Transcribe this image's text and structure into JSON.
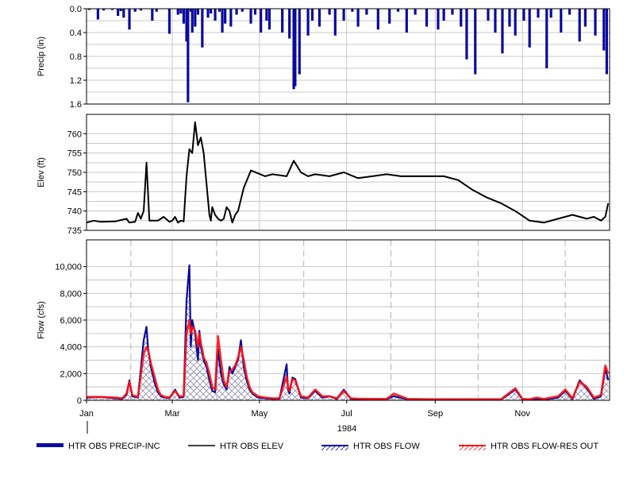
{
  "chart_data": [
    {
      "type": "bar",
      "ylabel": "Precip (in)",
      "ylim": [
        1.6,
        0.0
      ],
      "yticks": [
        "0.0",
        "0.4",
        "0.8",
        "1.2",
        "1.6"
      ],
      "ytick_values": [
        0.0,
        0.4,
        0.8,
        1.2,
        1.6
      ],
      "inverted_y": true,
      "grid": true,
      "series": [
        {
          "name": "HTR OBS PRECIP-INC",
          "color": "#0a0aa0",
          "x": [
            2,
            8,
            12,
            18,
            22,
            24,
            26,
            30,
            34,
            38,
            46,
            49,
            58,
            64,
            66,
            68,
            70,
            71,
            73,
            74,
            76,
            78,
            81,
            85,
            87,
            90,
            93,
            95,
            97,
            101,
            105,
            109,
            115,
            118,
            122,
            126,
            128,
            137,
            142,
            145,
            146,
            149,
            155,
            158,
            163,
            170,
            174,
            180,
            186,
            190,
            196,
            204,
            212,
            218,
            224,
            230,
            238,
            246,
            250,
            256,
            262,
            266,
            272,
            281,
            286,
            291,
            296,
            300,
            306,
            310,
            316,
            322,
            325,
            332,
            338,
            345,
            349,
            356,
            362,
            364
          ],
          "values": [
            0.02,
            0.18,
            0.03,
            0.02,
            0.12,
            0.04,
            0.15,
            0.35,
            0.05,
            0.03,
            0.2,
            0.05,
            0.42,
            0.1,
            0.08,
            0.25,
            0.55,
            1.57,
            0.05,
            0.4,
            0.3,
            0.1,
            0.65,
            0.15,
            0.08,
            0.2,
            0.05,
            0.4,
            0.25,
            0.3,
            0.1,
            0.05,
            0.25,
            0.1,
            0.4,
            0.2,
            0.35,
            0.4,
            0.5,
            1.35,
            1.3,
            1.1,
            0.45,
            0.2,
            0.3,
            0.1,
            0.45,
            0.2,
            0.05,
            0.3,
            0.1,
            0.35,
            0.25,
            0.05,
            0.4,
            0.1,
            0.3,
            0.35,
            0.2,
            0.1,
            0.3,
            0.85,
            1.1,
            0.2,
            0.4,
            0.75,
            0.3,
            0.45,
            0.2,
            0.65,
            0.15,
            1.0,
            0.15,
            0.4,
            0.1,
            0.55,
            0.3,
            0.45,
            0.7,
            1.1
          ]
        }
      ]
    },
    {
      "type": "line",
      "ylabel": "Elev (ft)",
      "ylim": [
        735,
        765
      ],
      "yticks": [
        "735",
        "740",
        "745",
        "750",
        "755",
        "760"
      ],
      "ytick_values": [
        735,
        740,
        745,
        750,
        755,
        760
      ],
      "grid": true,
      "series": [
        {
          "name": "HTR OBS ELEV",
          "color": "#000000",
          "x": [
            0,
            5,
            10,
            20,
            28,
            30,
            34,
            36,
            38,
            40,
            42,
            44,
            50,
            54,
            58,
            60,
            62,
            64,
            66,
            68,
            70,
            72,
            74,
            76,
            78,
            80,
            82,
            84,
            86,
            87,
            88,
            90,
            92,
            94,
            96,
            98,
            100,
            102,
            104,
            106,
            110,
            115,
            125,
            130,
            140,
            145,
            150,
            155,
            160,
            170,
            180,
            190,
            200,
            210,
            220,
            230,
            240,
            250,
            260,
            270,
            280,
            290,
            300,
            310,
            320,
            330,
            340,
            350,
            355,
            360,
            363,
            365
          ],
          "values": [
            737.0,
            737.5,
            737.2,
            737.3,
            738.0,
            737.0,
            737.2,
            739.5,
            738.0,
            740.0,
            752.5,
            737.5,
            737.5,
            738.5,
            737.2,
            737.5,
            738.5,
            737.0,
            737.5,
            737.3,
            749.0,
            756.0,
            755.0,
            763.0,
            757.0,
            759.0,
            755.0,
            747.0,
            739.0,
            737.5,
            741.0,
            739.0,
            738.0,
            737.5,
            738.0,
            741.0,
            740.0,
            737.0,
            739.0,
            740.0,
            746.0,
            750.5,
            749.0,
            749.5,
            749.0,
            753.0,
            750.0,
            749.0,
            749.5,
            749.0,
            750.0,
            748.5,
            749.0,
            749.5,
            749.0,
            749.0,
            749.0,
            749.0,
            748.0,
            745.5,
            743.5,
            742.0,
            740.0,
            737.5,
            737.0,
            738.0,
            739.0,
            738.0,
            738.5,
            737.5,
            738.5,
            742.0
          ]
        }
      ]
    },
    {
      "type": "area",
      "ylabel": "Flow (cfs)",
      "xlabel": "1984",
      "ylim": [
        0,
        12000
      ],
      "yticks": [
        "0",
        "2,000",
        "4,000",
        "6,000",
        "8,000",
        "10,000"
      ],
      "ytick_values": [
        0,
        2000,
        4000,
        6000,
        8000,
        10000
      ],
      "categories": [
        "Jan",
        "Mar",
        "May",
        "Jul",
        "Sep",
        "Nov"
      ],
      "category_days": [
        0,
        60,
        121,
        182,
        244,
        305
      ],
      "xlim": [
        0,
        366
      ],
      "grid": true,
      "series": [
        {
          "name": "HTR OBS FLOW",
          "color": "#0a0aa0",
          "x": [
            0,
            10,
            20,
            25,
            28,
            30,
            32,
            36,
            40,
            42,
            43,
            45,
            48,
            50,
            52,
            55,
            58,
            62,
            65,
            68,
            70,
            72,
            73,
            74,
            76,
            78,
            79,
            80,
            81,
            82,
            84,
            86,
            88,
            90,
            92,
            94,
            96,
            98,
            100,
            102,
            104,
            106,
            108,
            110,
            112,
            114,
            116,
            120,
            125,
            130,
            135,
            140,
            141,
            142,
            144,
            146,
            150,
            155,
            160,
            165,
            170,
            175,
            180,
            185,
            190,
            200,
            210,
            215,
            225,
            240,
            260,
            270,
            280,
            290,
            300,
            305,
            310,
            315,
            320,
            330,
            335,
            340,
            345,
            350,
            355,
            360,
            363,
            365
          ],
          "values": [
            200,
            250,
            150,
            100,
            400,
            1500,
            300,
            200,
            4500,
            5500,
            4000,
            2500,
            1200,
            600,
            300,
            200,
            150,
            800,
            200,
            250,
            7500,
            10100,
            4000,
            6000,
            5000,
            3000,
            5200,
            4000,
            3500,
            3000,
            2500,
            1500,
            700,
            600,
            3800,
            2000,
            1200,
            800,
            2500,
            2000,
            2500,
            3000,
            4500,
            2500,
            1500,
            800,
            500,
            200,
            150,
            100,
            120,
            2700,
            800,
            500,
            1700,
            1600,
            200,
            150,
            700,
            200,
            300,
            100,
            800,
            100,
            80,
            60,
            80,
            300,
            60,
            50,
            50,
            40,
            50,
            40,
            800,
            60,
            50,
            100,
            50,
            200,
            700,
            80,
            1500,
            900,
            100,
            300,
            2400,
            1500
          ]
        },
        {
          "name": "HTR OBS FLOW-RES OUT",
          "color": "#ff1010",
          "x": [
            0,
            10,
            20,
            25,
            28,
            30,
            32,
            36,
            40,
            42,
            43,
            45,
            48,
            50,
            52,
            55,
            58,
            62,
            65,
            68,
            70,
            72,
            73,
            74,
            76,
            78,
            79,
            80,
            81,
            82,
            84,
            86,
            88,
            90,
            92,
            94,
            96,
            98,
            100,
            102,
            104,
            106,
            108,
            110,
            112,
            114,
            116,
            120,
            125,
            130,
            135,
            140,
            141,
            142,
            144,
            146,
            150,
            155,
            160,
            165,
            170,
            175,
            180,
            185,
            190,
            200,
            210,
            215,
            225,
            240,
            260,
            270,
            280,
            290,
            300,
            305,
            310,
            315,
            320,
            330,
            335,
            340,
            345,
            350,
            355,
            360,
            363,
            365
          ],
          "values": [
            250,
            250,
            200,
            150,
            500,
            1400,
            400,
            250,
            3500,
            4000,
            3800,
            2800,
            1600,
            800,
            400,
            250,
            200,
            700,
            300,
            300,
            5000,
            6000,
            5000,
            5500,
            5200,
            4000,
            5000,
            4300,
            3800,
            3200,
            2800,
            2000,
            1000,
            800,
            4800,
            3000,
            1500,
            1000,
            2200,
            2300,
            2600,
            3200,
            4000,
            3000,
            1800,
            1000,
            600,
            300,
            200,
            150,
            150,
            1800,
            1000,
            700,
            1600,
            1500,
            300,
            200,
            800,
            300,
            300,
            150,
            700,
            150,
            120,
            100,
            100,
            500,
            100,
            80,
            80,
            80,
            80,
            80,
            900,
            100,
            80,
            200,
            100,
            300,
            800,
            150,
            1400,
            1000,
            200,
            400,
            2600,
            2000
          ]
        }
      ]
    }
  ],
  "legend": {
    "placement": "bottom",
    "items": [
      {
        "label": "HTR OBS PRECIP-INC",
        "color": "#0a0aa0",
        "style": "thick-line"
      },
      {
        "label": "HTR OBS ELEV",
        "color": "#000000",
        "style": "line"
      },
      {
        "label": "HTR OBS FLOW",
        "color": "#0a0aa0",
        "style": "hatched-line"
      },
      {
        "label": "HTR OBS FLOW-RES OUT",
        "color": "#ff1010",
        "style": "hatched-line"
      }
    ]
  },
  "colors": {
    "grid": "#c8c8c8",
    "dashed_month": "#b4b4b4",
    "frame": "#000000"
  }
}
